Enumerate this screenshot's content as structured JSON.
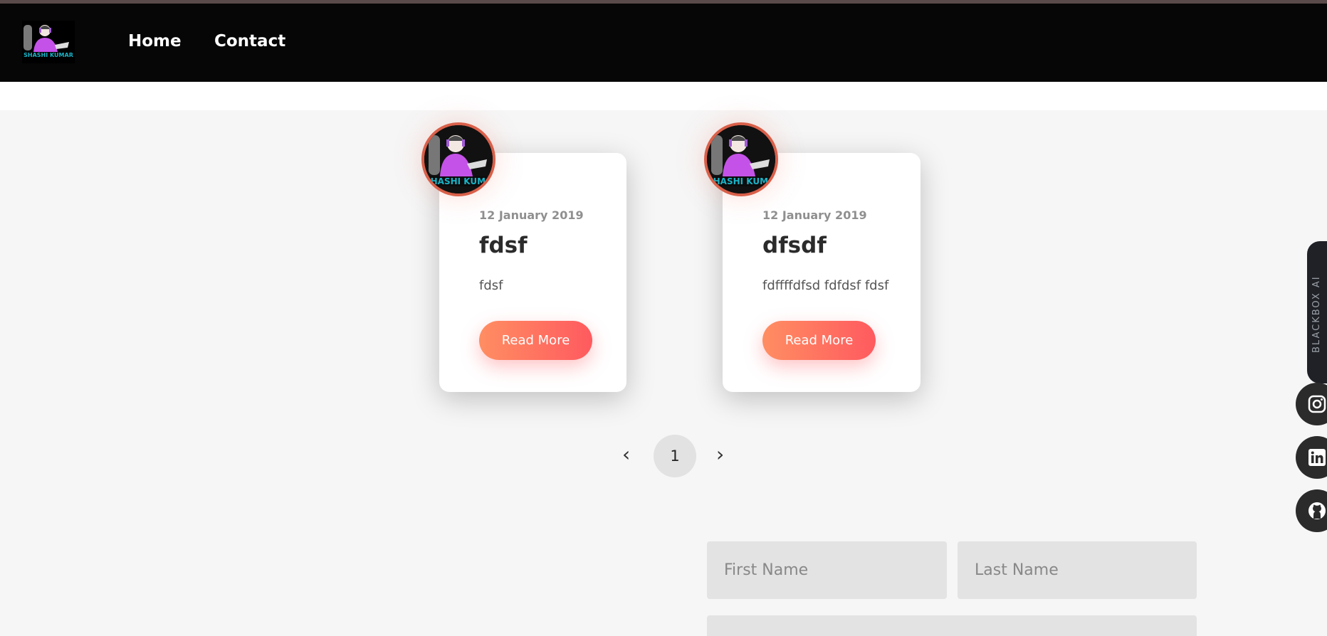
{
  "nav": {
    "logo_text": "SHASHI KUMAR",
    "links": [
      "Home",
      "Contact"
    ]
  },
  "posts": [
    {
      "date": "12 January 2019",
      "title": "fdsf",
      "excerpt": "fdsf",
      "button": "Read More"
    },
    {
      "date": "12 January 2019",
      "title": "dfsdf",
      "excerpt": "fdffffdfsd fdfdsf fdsf",
      "button": "Read More"
    }
  ],
  "pagination": {
    "prev": "‹",
    "current": "1",
    "next": "›"
  },
  "contact_form": {
    "first_name_placeholder": "First Name",
    "last_name_placeholder": "Last Name"
  },
  "side_widget": {
    "label": "BLACKBOX AI"
  },
  "social_icons": [
    "instagram-icon",
    "linkedin-icon",
    "github-icon"
  ],
  "colors": {
    "navbar": "#060606",
    "button_gradient_start": "#ff8e62",
    "button_gradient_end": "#ff5a5f",
    "avatar_border": "#d9604a"
  }
}
